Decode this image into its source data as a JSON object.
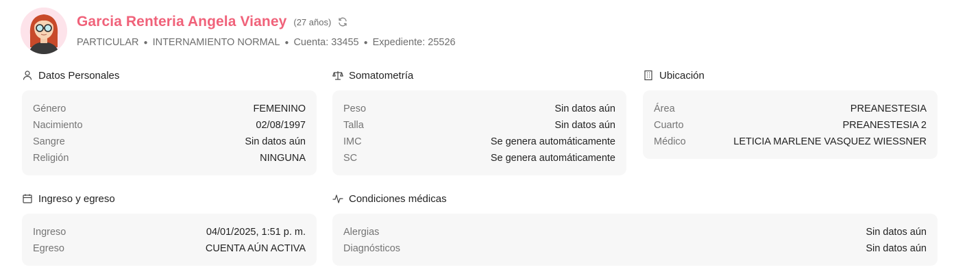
{
  "patient": {
    "name": "Garcia Renteria Angela Vianey",
    "age": "(27 años)",
    "meta": [
      "PARTICULAR",
      "INTERNAMIENTO NORMAL",
      "Cuenta: 33455",
      "Expediente: 25526"
    ]
  },
  "sections": {
    "personal": {
      "title": "Datos Personales",
      "rows": [
        {
          "label": "Género",
          "value": "FEMENINO"
        },
        {
          "label": "Nacimiento",
          "value": "02/08/1997"
        },
        {
          "label": "Sangre",
          "value": "Sin datos aún"
        },
        {
          "label": "Religión",
          "value": "NINGUNA"
        }
      ]
    },
    "somatometry": {
      "title": "Somatometría",
      "rows": [
        {
          "label": "Peso",
          "value": "Sin datos aún"
        },
        {
          "label": "Talla",
          "value": "Sin datos aún"
        },
        {
          "label": "IMC",
          "value": "Se genera automáticamente"
        },
        {
          "label": "SC",
          "value": "Se genera automáticamente"
        }
      ]
    },
    "location": {
      "title": "Ubicación",
      "rows": [
        {
          "label": "Área",
          "value": "PREANESTESIA"
        },
        {
          "label": "Cuarto",
          "value": "PREANESTESIA 2"
        },
        {
          "label": "Médico",
          "value": "LETICIA MARLENE VASQUEZ WIESSNER"
        }
      ]
    },
    "admission": {
      "title": "Ingreso y egreso",
      "rows": [
        {
          "label": "Ingreso",
          "value": "04/01/2025, 1:51 p. m."
        },
        {
          "label": "Egreso",
          "value": "CUENTA AÚN ACTIVA"
        }
      ]
    },
    "conditions": {
      "title": "Condiciones médicas",
      "rows": [
        {
          "label": "Alergias",
          "value": "Sin datos aún"
        },
        {
          "label": "Diagnósticos",
          "value": "Sin datos aún"
        }
      ]
    }
  },
  "icons": {
    "section_personal": "user-icon",
    "section_somatometry": "scale-icon",
    "section_location": "building-icon",
    "section_admission": "calendar-icon",
    "section_conditions": "activity-icon",
    "refresh": "refresh-icon"
  },
  "colors": {
    "accent": "#f0627a",
    "card_bg": "#f7f7f7",
    "label": "#747474"
  }
}
